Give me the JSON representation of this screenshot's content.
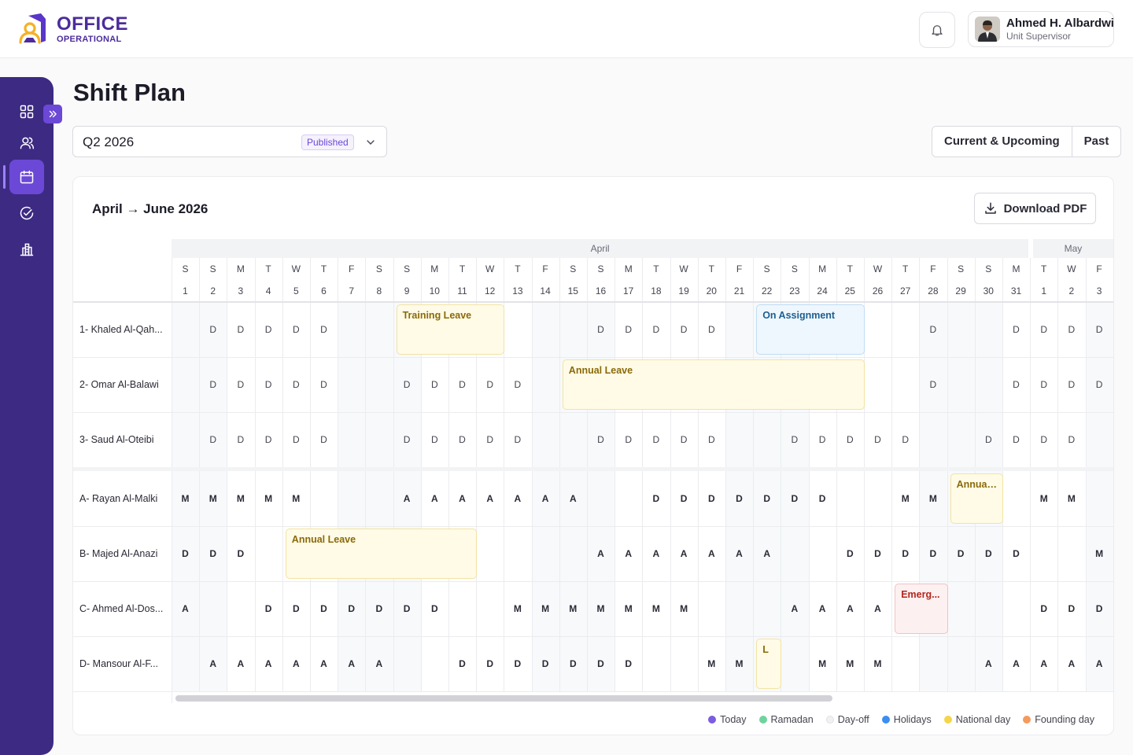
{
  "app": {
    "logo_line1": "OFFICE",
    "logo_line2": "OPERATIONAL",
    "brand_color": "#4c2c9c"
  },
  "user": {
    "name": "Ahmed H. Albardwi",
    "role": "Unit Supervisor"
  },
  "sidebar": {
    "items": [
      {
        "icon": "dashboard-icon",
        "active": false
      },
      {
        "icon": "users-icon",
        "active": false
      },
      {
        "icon": "calendar-icon",
        "active": true
      },
      {
        "icon": "check-circle-icon",
        "active": false
      },
      {
        "icon": "building-icon",
        "active": false
      }
    ]
  },
  "page": {
    "title": "Shift Plan",
    "quarter": "Q2 2026",
    "status_badge": "Published",
    "tabs": [
      "Current & Upcoming",
      "Past"
    ],
    "range_title": "April → June 2026",
    "download_label": "Download PDF"
  },
  "calendar": {
    "months": [
      {
        "name": "April",
        "days": 31
      },
      {
        "name": "May",
        "days": 3
      }
    ],
    "days": [
      [
        "S",
        "1"
      ],
      [
        "S",
        "2"
      ],
      [
        "M",
        "3"
      ],
      [
        "T",
        "4"
      ],
      [
        "W",
        "5"
      ],
      [
        "T",
        "6"
      ],
      [
        "F",
        "7"
      ],
      [
        "S",
        "8"
      ],
      [
        "S",
        "9"
      ],
      [
        "M",
        "10"
      ],
      [
        "T",
        "11"
      ],
      [
        "W",
        "12"
      ],
      [
        "T",
        "13"
      ],
      [
        "F",
        "14"
      ],
      [
        "S",
        "15"
      ],
      [
        "S",
        "16"
      ],
      [
        "M",
        "17"
      ],
      [
        "T",
        "18"
      ],
      [
        "W",
        "19"
      ],
      [
        "T",
        "20"
      ],
      [
        "F",
        "21"
      ],
      [
        "S",
        "22"
      ],
      [
        "S",
        "23"
      ],
      [
        "M",
        "24"
      ],
      [
        "T",
        "25"
      ],
      [
        "W",
        "26"
      ],
      [
        "T",
        "27"
      ],
      [
        "F",
        "28"
      ],
      [
        "S",
        "29"
      ],
      [
        "S",
        "30"
      ],
      [
        "M",
        "31"
      ],
      [
        "T",
        "1"
      ],
      [
        "W",
        "2"
      ],
      [
        "F",
        "3"
      ]
    ],
    "rows": [
      {
        "name": "1- Khaled Al-Qah...",
        "group": 1,
        "cells": [
          "",
          "D",
          "D",
          "D",
          "D",
          "D",
          "",
          "",
          "D",
          "",
          "",
          "",
          "",
          "",
          "",
          "D",
          "D",
          "D",
          "D",
          "D",
          "",
          "",
          "",
          "",
          "",
          "",
          "",
          "D",
          "",
          "",
          "D",
          "D",
          "D",
          "D",
          ""
        ],
        "events": [
          {
            "label": "Training Leave",
            "start": 9,
            "end": 12,
            "color": "yellow"
          },
          {
            "label": "On Assignment",
            "start": 22,
            "end": 25,
            "color": "blue"
          }
        ]
      },
      {
        "name": "2- Omar Al-Balawi",
        "group": 1,
        "cells": [
          "",
          "D",
          "D",
          "D",
          "D",
          "D",
          "",
          "",
          "D",
          "D",
          "D",
          "D",
          "D",
          "",
          "",
          "",
          "",
          "",
          "",
          "",
          "",
          "",
          "",
          "",
          "",
          "",
          "",
          "D",
          "",
          "",
          "D",
          "D",
          "D",
          "D",
          ""
        ],
        "events": [
          {
            "label": "Annual Leave",
            "start": 15,
            "end": 25,
            "color": "yellow"
          }
        ]
      },
      {
        "name": "3- Saud Al-Oteibi",
        "group": 1,
        "cells": [
          "",
          "D",
          "D",
          "D",
          "D",
          "D",
          "",
          "",
          "D",
          "D",
          "D",
          "D",
          "D",
          "",
          "",
          "D",
          "D",
          "D",
          "D",
          "D",
          "",
          "",
          "D",
          "D",
          "D",
          "D",
          "D",
          "",
          "",
          "D",
          "D",
          "D",
          "D",
          ""
        ],
        "events": []
      },
      {
        "name": "A- Rayan Al-Malki",
        "group": 2,
        "cells": [
          "M",
          "M",
          "M",
          "M",
          "M",
          "",
          "",
          "",
          "A",
          "A",
          "A",
          "A",
          "A",
          "A",
          "A",
          "",
          "",
          "D",
          "D",
          "D",
          "D",
          "D",
          "D",
          "D",
          "",
          "",
          "M",
          "M",
          "M",
          "",
          "",
          "M",
          "M",
          ""
        ],
        "events": [
          {
            "label": "Annual...",
            "start": 29,
            "end": 30,
            "color": "yellow"
          }
        ]
      },
      {
        "name": "B- Majed Al-Anazi",
        "group": 2,
        "cells": [
          "D",
          "D",
          "D",
          "",
          "",
          "",
          "",
          "",
          "",
          "",
          "",
          "",
          "",
          "",
          "",
          "A",
          "A",
          "A",
          "A",
          "A",
          "A",
          "A",
          "",
          "",
          "D",
          "D",
          "D",
          "D",
          "D",
          "D",
          "D",
          "",
          "",
          "M"
        ],
        "events": [
          {
            "label": "Annual Leave",
            "start": 5,
            "end": 11,
            "color": "yellow"
          }
        ]
      },
      {
        "name": "C- Ahmed Al-Dos...",
        "group": 2,
        "cells": [
          "A",
          "",
          "",
          "D",
          "D",
          "D",
          "D",
          "D",
          "D",
          "D",
          "",
          "",
          "M",
          "M",
          "M",
          "M",
          "M",
          "M",
          "M",
          "",
          "",
          "",
          "A",
          "A",
          "A",
          "A",
          "A",
          "",
          "",
          "",
          "",
          "D",
          "D",
          "D"
        ],
        "events": [
          {
            "label": "Emerg...",
            "start": 27,
            "end": 28,
            "color": "red"
          }
        ]
      },
      {
        "name": "D- Mansour Al-F...",
        "group": 2,
        "cells": [
          "",
          "A",
          "A",
          "A",
          "A",
          "A",
          "A",
          "A",
          "",
          "",
          "D",
          "D",
          "D",
          "D",
          "D",
          "D",
          "D",
          "",
          "",
          "M",
          "M",
          "M",
          "",
          "M",
          "M",
          "M",
          "",
          "",
          "",
          "A",
          "A",
          "A",
          "A",
          "A"
        ],
        "events": [
          {
            "label": "L",
            "start": 22,
            "end": 22,
            "color": "yellow"
          }
        ]
      }
    ]
  },
  "legend": [
    {
      "label": "Today",
      "color": "#7c5ce0"
    },
    {
      "label": "Ramadan",
      "color": "#6fd3a0"
    },
    {
      "label": "Day-off",
      "color": "#f1f1f3"
    },
    {
      "label": "Holidays",
      "color": "#3b8ef0"
    },
    {
      "label": "National day",
      "color": "#f5d54a"
    },
    {
      "label": "Founding day",
      "color": "#f59a5a"
    }
  ]
}
